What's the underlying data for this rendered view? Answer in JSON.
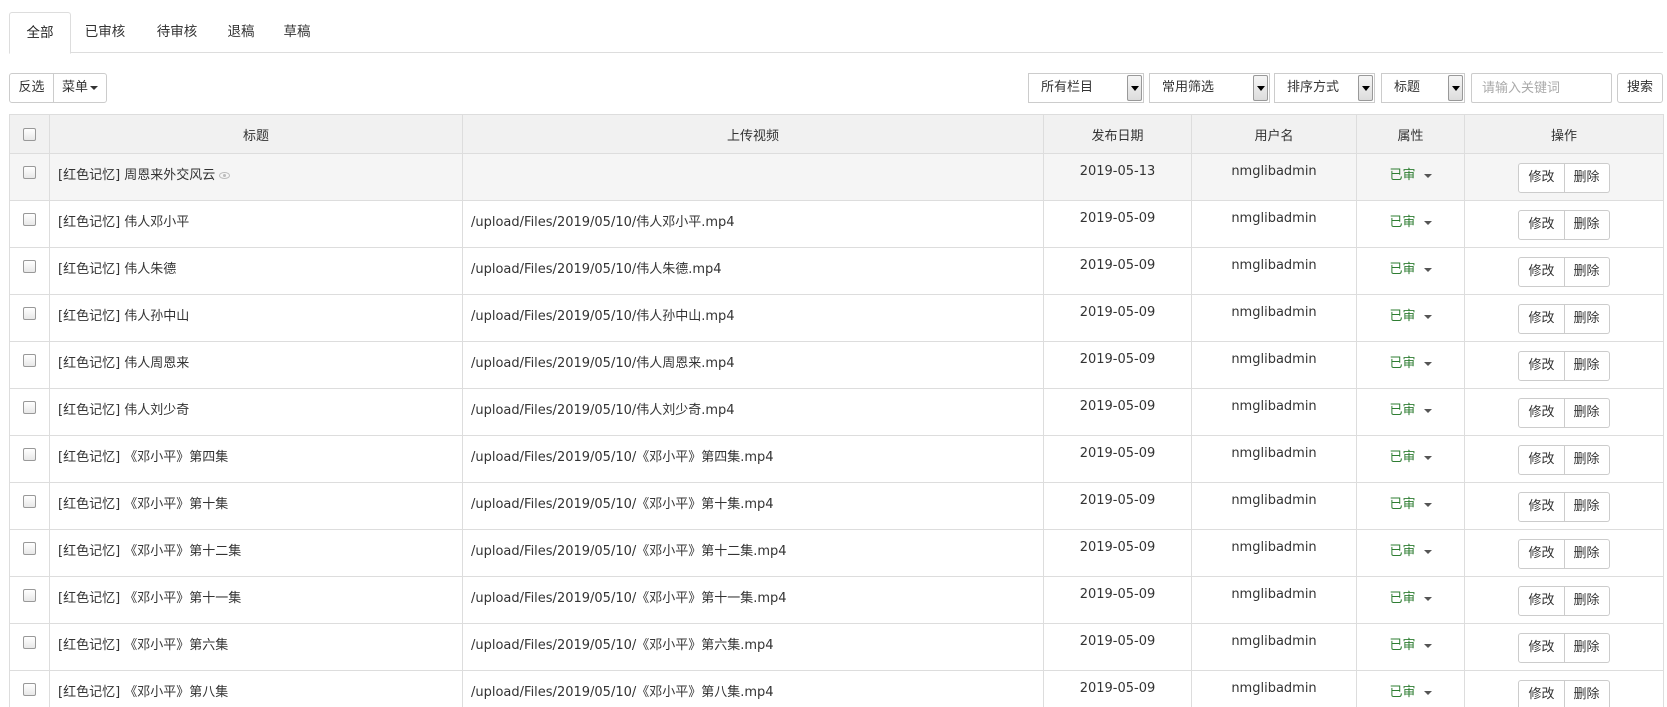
{
  "tabs": [
    {
      "label": "全部",
      "active": true
    },
    {
      "label": "已审核",
      "active": false
    },
    {
      "label": "待审核",
      "active": false
    },
    {
      "label": "退稿",
      "active": false
    },
    {
      "label": "草稿",
      "active": false
    }
  ],
  "toolbar": {
    "invert_label": "反选",
    "menu_label": "菜单",
    "column_select": "所有栏目",
    "filter_select": "常用筛选",
    "sort_select": "排序方式",
    "field_select": "标题",
    "search_placeholder": "请输入关键词",
    "search_label": "搜索"
  },
  "table": {
    "headers": [
      "标题",
      "上传视频",
      "发布日期",
      "用户名",
      "属性",
      "操作"
    ],
    "edit_label": "修改",
    "delete_label": "删除",
    "rows": [
      {
        "title": "[红色记忆] 周恩来外交风云",
        "video": "",
        "date": "2019-05-13",
        "user": "nmglibadmin",
        "attr": "已审",
        "viewed": true
      },
      {
        "title": "[红色记忆] 伟人邓小平",
        "video": "/upload/Files/2019/05/10/伟人邓小平.mp4",
        "date": "2019-05-09",
        "user": "nmglibadmin",
        "attr": "已审"
      },
      {
        "title": "[红色记忆] 伟人朱德",
        "video": "/upload/Files/2019/05/10/伟人朱德.mp4",
        "date": "2019-05-09",
        "user": "nmglibadmin",
        "attr": "已审"
      },
      {
        "title": "[红色记忆] 伟人孙中山",
        "video": "/upload/Files/2019/05/10/伟人孙中山.mp4",
        "date": "2019-05-09",
        "user": "nmglibadmin",
        "attr": "已审"
      },
      {
        "title": "[红色记忆] 伟人周恩来",
        "video": "/upload/Files/2019/05/10/伟人周恩来.mp4",
        "date": "2019-05-09",
        "user": "nmglibadmin",
        "attr": "已审"
      },
      {
        "title": "[红色记忆] 伟人刘少奇",
        "video": "/upload/Files/2019/05/10/伟人刘少奇.mp4",
        "date": "2019-05-09",
        "user": "nmglibadmin",
        "attr": "已审"
      },
      {
        "title": "[红色记忆] 《邓小平》第四集",
        "video": "/upload/Files/2019/05/10/《邓小平》第四集.mp4",
        "date": "2019-05-09",
        "user": "nmglibadmin",
        "attr": "已审"
      },
      {
        "title": "[红色记忆] 《邓小平》第十集",
        "video": "/upload/Files/2019/05/10/《邓小平》第十集.mp4",
        "date": "2019-05-09",
        "user": "nmglibadmin",
        "attr": "已审"
      },
      {
        "title": "[红色记忆] 《邓小平》第十二集",
        "video": "/upload/Files/2019/05/10/《邓小平》第十二集.mp4",
        "date": "2019-05-09",
        "user": "nmglibadmin",
        "attr": "已审"
      },
      {
        "title": "[红色记忆] 《邓小平》第十一集",
        "video": "/upload/Files/2019/05/10/《邓小平》第十一集.mp4",
        "date": "2019-05-09",
        "user": "nmglibadmin",
        "attr": "已审"
      },
      {
        "title": "[红色记忆] 《邓小平》第六集",
        "video": "/upload/Files/2019/05/10/《邓小平》第六集.mp4",
        "date": "2019-05-09",
        "user": "nmglibadmin",
        "attr": "已审"
      },
      {
        "title": "[红色记忆] 《邓小平》第八集",
        "video": "/upload/Files/2019/05/10/《邓小平》第八集.mp4",
        "date": "2019-05-09",
        "user": "nmglibadmin",
        "attr": "已审"
      }
    ]
  }
}
